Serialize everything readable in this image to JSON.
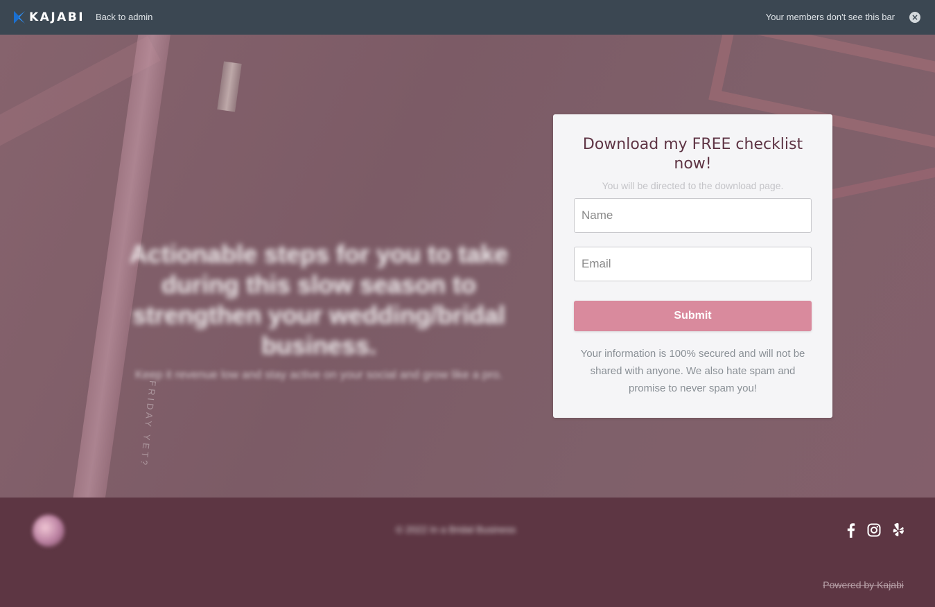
{
  "admin_bar": {
    "brand": "KAJABI",
    "back_label": "Back to admin",
    "notice": "Your members don't see this bar",
    "close_icon": "close-icon"
  },
  "hero": {
    "heading": "Actionable steps for you to take during this slow season to strengthen your wedding/bridal business.",
    "subheading": "Keep it revenue low and stay active on your social and grow like a pro."
  },
  "form": {
    "title": "Download my FREE checklist now!",
    "subtitle": "You will be directed to the download page.",
    "name_placeholder": "Name",
    "email_placeholder": "Email",
    "submit_label": "Submit",
    "privacy_text": "Your information is 100% secured and will not be shared with anyone. We also hate spam and promise to never spam you!",
    "button_color": "#d98a9d",
    "title_color": "#5e3444"
  },
  "footer": {
    "copyright": "© 2022 In a Bridal Business",
    "social_icons": [
      "facebook-icon",
      "instagram-icon",
      "yelp-icon"
    ],
    "powered_by": "Powered by Kajabi",
    "background": "#5d3643"
  }
}
